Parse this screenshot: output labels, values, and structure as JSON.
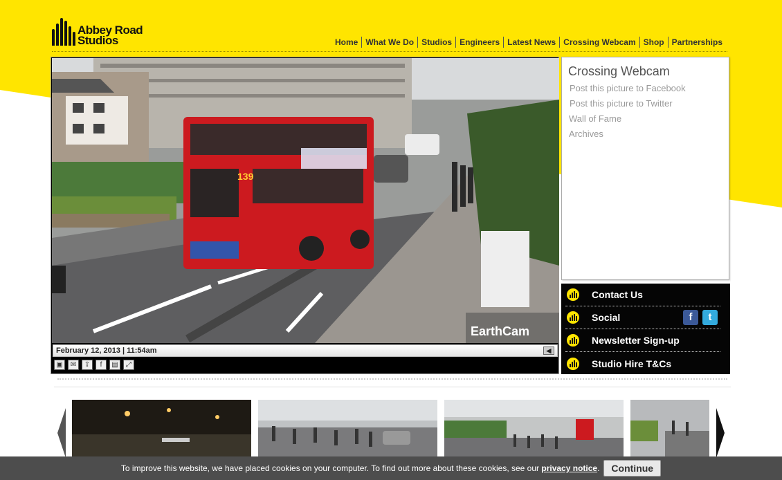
{
  "brand": {
    "logo_line1": "Abbey Road",
    "logo_line2": "Studios",
    "yellow": "#ffe500"
  },
  "nav": {
    "items": [
      "Home",
      "What We Do",
      "Studios",
      "Engineers",
      "Latest News",
      "Crossing Webcam",
      "Shop",
      "Partnerships"
    ]
  },
  "webcam": {
    "timestamp": "February 12, 2013 | 11:54am",
    "watermark": "EarthCam",
    "bus_route": "139",
    "tools": [
      "photo-icon",
      "email-icon",
      "share-icon",
      "facebook-icon",
      "postcard-icon",
      "fullscreen-icon"
    ],
    "mute_icon": "speaker-icon"
  },
  "sidepanel": {
    "title": "Crossing Webcam",
    "links": [
      "Post this picture to Facebook",
      "Post this picture to Twitter",
      "Wall of Fame",
      "Archives"
    ]
  },
  "blackpanel": {
    "items": [
      "Contact Us",
      "Social",
      "Newsletter Sign-up",
      "Studio Hire T&Cs"
    ],
    "social_icons": [
      "f",
      "t"
    ]
  },
  "carousel": {
    "thumbs": [
      "night-crossing",
      "crowd-crossing",
      "park-crossing",
      "side-crossing"
    ]
  },
  "cookie": {
    "text": "To improve this website, we have placed cookies on your computer. To find out more about these cookies, see our",
    "link": "privacy notice",
    "period": ".",
    "button": "Continue"
  }
}
